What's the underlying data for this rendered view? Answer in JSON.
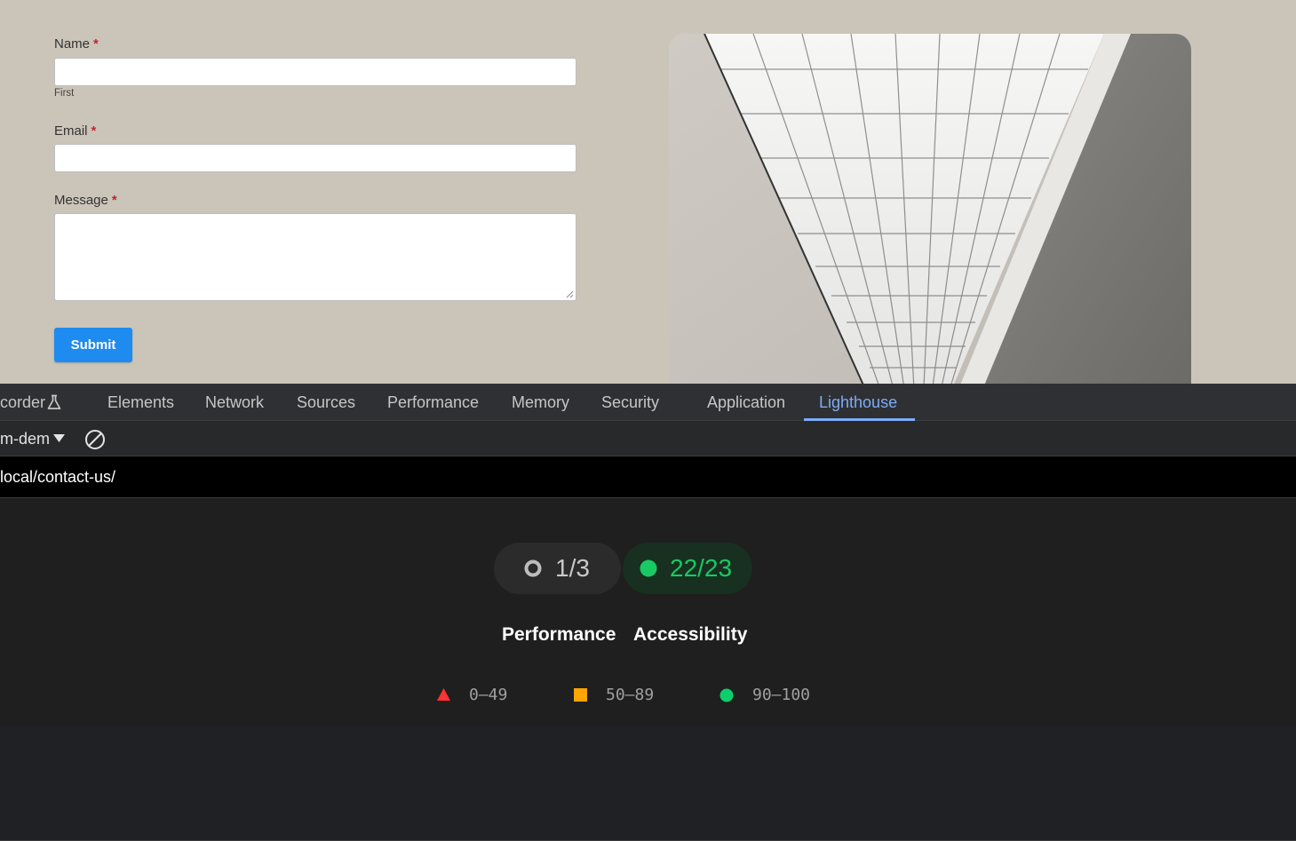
{
  "form": {
    "name_label": "Name",
    "name_sublabel": "First",
    "email_label": "Email",
    "message_label": "Message",
    "required_marker": "*",
    "name_value": "",
    "email_value": "",
    "message_value": "",
    "submit_label": "Submit"
  },
  "devtools": {
    "tabs": [
      {
        "label": "corder",
        "active": false
      },
      {
        "label": "Elements",
        "active": false
      },
      {
        "label": "Network",
        "active": false
      },
      {
        "label": "Sources",
        "active": false
      },
      {
        "label": "Performance",
        "active": false
      },
      {
        "label": "Memory",
        "active": false
      },
      {
        "label": "Security",
        "active": false
      },
      {
        "label": "Application",
        "active": false
      },
      {
        "label": "Lighthouse",
        "active": true
      }
    ],
    "toolbar": {
      "report_select_value": "m-demo"
    },
    "url": "local/contact-us/",
    "report": {
      "categories": [
        {
          "label": "Performance",
          "score": "1/3",
          "status": "neutral"
        },
        {
          "label": "Accessibility",
          "score": "22/23",
          "status": "pass"
        }
      ],
      "legend": [
        {
          "range": "0–49",
          "shape": "triangle",
          "color": "#ff3333"
        },
        {
          "range": "50–89",
          "shape": "square",
          "color": "#ffa400"
        },
        {
          "range": "90–100",
          "shape": "circle",
          "color": "#0cce6b"
        }
      ]
    }
  },
  "colors": {
    "page_bg": "#cbc5b9",
    "submit_bg": "#1e8bf0",
    "required": "#c0262e",
    "active_tab": "#7cacf8",
    "pass_green": "#18c964"
  }
}
